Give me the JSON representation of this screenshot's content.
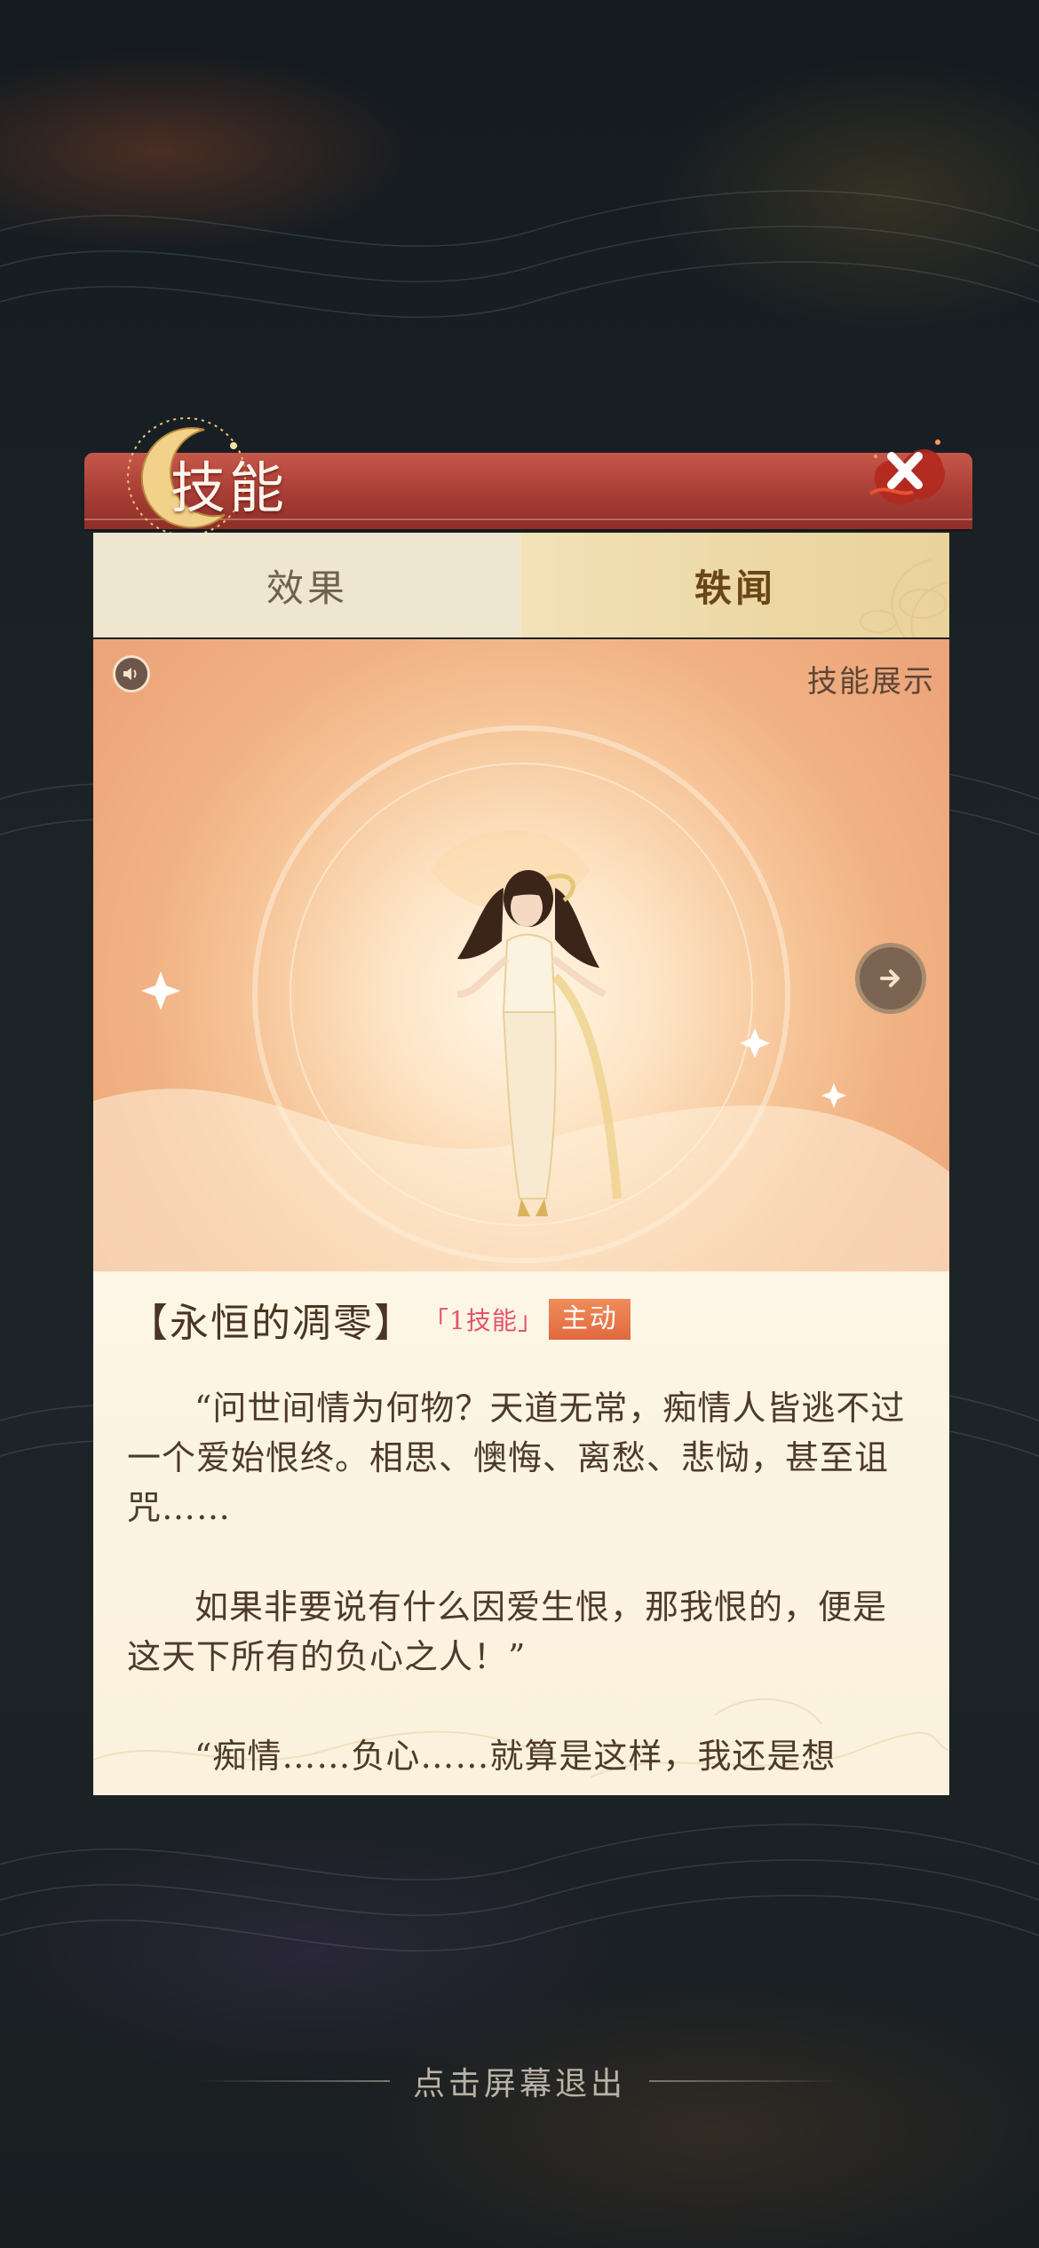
{
  "header": {
    "title": "技能",
    "close_icon": "close-x-icon"
  },
  "tabs": [
    {
      "label": "效果",
      "active": false
    },
    {
      "label": "轶闻",
      "active": true
    }
  ],
  "showcase": {
    "label": "技能展示",
    "speaker_icon": "speaker-icon",
    "next_icon": "arrow-right-icon"
  },
  "skill": {
    "name": "【永恒的凋零】",
    "tag_number": "「1技能」",
    "tag_type": "主动"
  },
  "lore": {
    "paragraphs": [
      "“问世间情为何物？天道无常，痴情人皆逃不过一个爱始恨终。相思、懊悔、离愁、悲恸，甚至诅咒……",
      "如果非要说有什么因爱生恨，那我恨的，便是这天下所有的负心之人！”",
      "“痴情……负心……就算是这样，我还是想"
    ]
  },
  "footer": {
    "exit_hint": "点击屏幕退出"
  },
  "colors": {
    "banner": "#a83d35",
    "accent_tag": "#e0693f",
    "tag_pink": "#e2546a",
    "panel_bg": "#fbf1dc"
  }
}
